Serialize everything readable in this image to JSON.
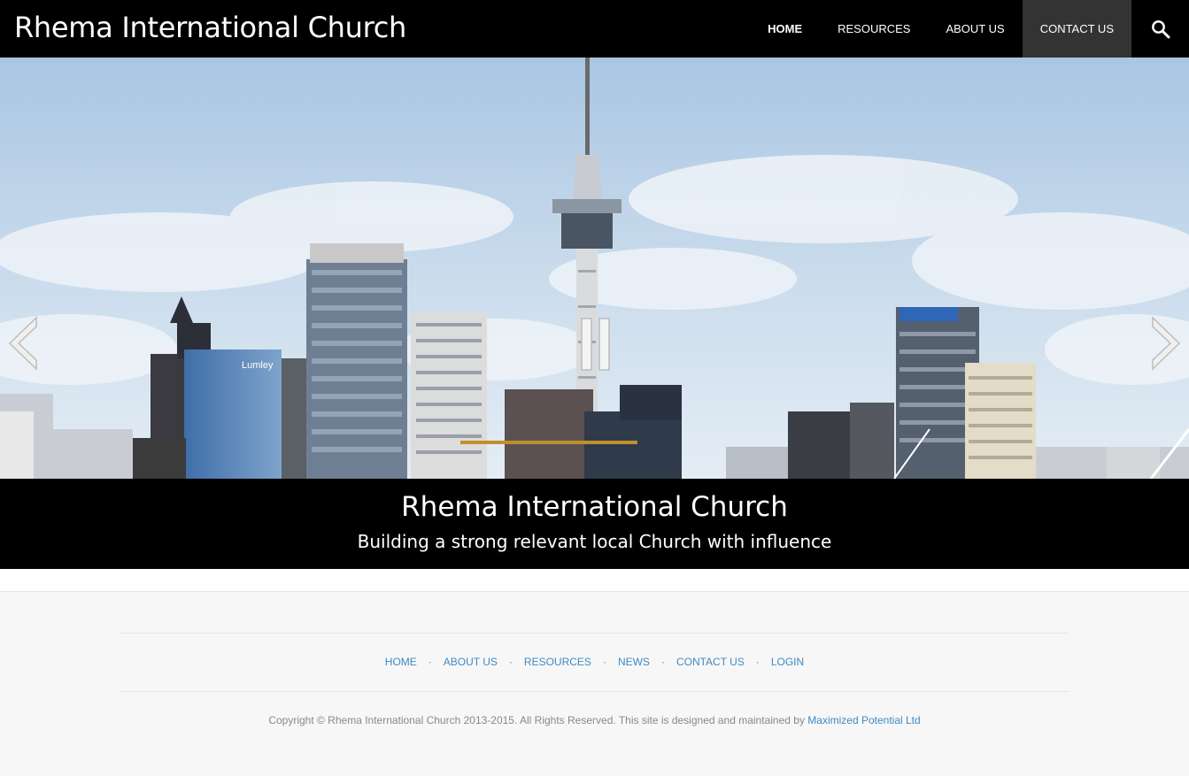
{
  "header": {
    "site_title": "Rhema International Church",
    "nav": [
      {
        "label": "HOME"
      },
      {
        "label": "RESOURCES"
      },
      {
        "label": "ABOUT US"
      },
      {
        "label": "CONTACT US"
      }
    ],
    "search_icon": "search-icon"
  },
  "slider": {
    "prev_icon": "arrow-left-icon",
    "next_icon": "arrow-right-icon",
    "pause_icon": "pause-icon",
    "building_sign_left": "Lumley",
    "caption_title": "Rhema International Church",
    "caption_subtitle": "Building a strong relevant local Church with influence"
  },
  "footer": {
    "links": [
      {
        "label": "HOME"
      },
      {
        "label": "ABOUT US"
      },
      {
        "label": "RESOURCES"
      },
      {
        "label": "NEWS"
      },
      {
        "label": "CONTACT US"
      },
      {
        "label": "LOGIN"
      }
    ],
    "separator": "·",
    "copyright_text": "Copyright © Rhema International Church 2013-2015. All Rights Reserved. This site is designed and maintained by ",
    "credit_link": "Maximized Potential Ltd"
  },
  "colors": {
    "header_bg": "#000000",
    "link_blue": "#3d8bc6",
    "footer_bg": "#f7f7f7"
  }
}
